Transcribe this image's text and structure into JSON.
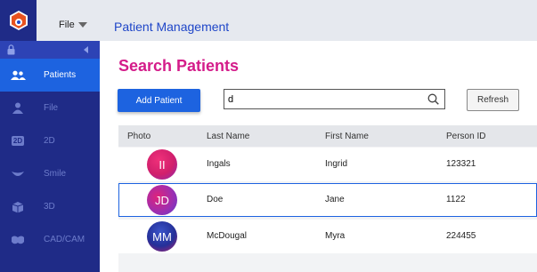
{
  "header": {
    "file_menu": "File",
    "app_title": "Patient Management"
  },
  "sidebar": {
    "items": [
      {
        "label": "Patients",
        "icon": "users-icon",
        "active": true
      },
      {
        "label": "File",
        "icon": "person-icon",
        "active": false
      },
      {
        "label": "2D",
        "icon": "2d-icon",
        "active": false
      },
      {
        "label": "Smile",
        "icon": "smile-icon",
        "active": false
      },
      {
        "label": "3D",
        "icon": "3d-icon",
        "active": false
      },
      {
        "label": "CAD/CAM",
        "icon": "cadcam-icon",
        "active": false
      }
    ]
  },
  "main": {
    "title": "Search Patients",
    "add_button": "Add Patient",
    "search": {
      "value": "d",
      "placeholder": ""
    },
    "refresh_button": "Refresh"
  },
  "table": {
    "columns": [
      "Photo",
      "Last Name",
      "First Name",
      "Person ID"
    ],
    "rows": [
      {
        "initials": "II",
        "last": "Ingals",
        "first": "Ingrid",
        "id": "123321",
        "selected": false
      },
      {
        "initials": "JD",
        "last": "Doe",
        "first": "Jane",
        "id": "1122",
        "selected": true
      },
      {
        "initials": "MM",
        "last": "McDougal",
        "first": "Myra",
        "id": "224455",
        "selected": false
      }
    ]
  },
  "colors": {
    "accent": "#1d63e0",
    "sidebar": "#1f2b87",
    "title": "#d41c8a",
    "avatar_1": "#e2256f",
    "avatar_2": "#b42aa0",
    "avatar_3": "#1f2b87"
  }
}
